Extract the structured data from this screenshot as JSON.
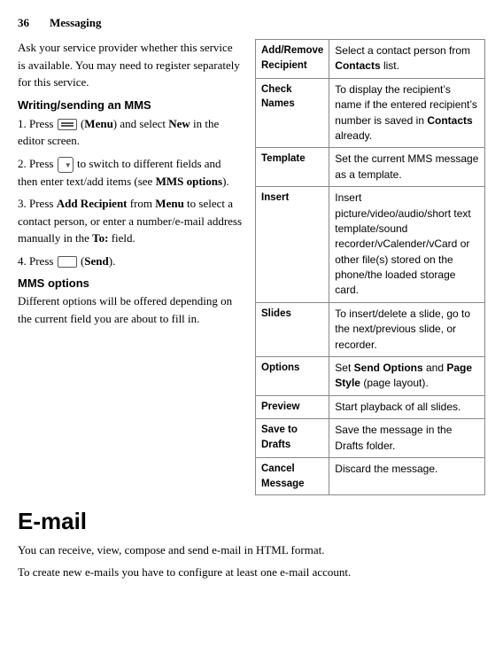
{
  "header": {
    "page_number": "36",
    "chapter": "Messaging"
  },
  "left": {
    "intro": "Ask your service provider whether this service is available. You may need to register separately for this service.",
    "writing_heading": "Writing/sending an MMS",
    "steps": [
      {
        "num": "1.",
        "parts": [
          {
            "text": "Press ",
            "type": "normal"
          },
          {
            "text": "icon_menu",
            "type": "icon"
          },
          {
            "text": " (",
            "type": "normal"
          },
          {
            "text": "Menu",
            "type": "bold"
          },
          {
            "text": ") and select ",
            "type": "normal"
          },
          {
            "text": "New",
            "type": "bold"
          },
          {
            "text": " in the editor screen.",
            "type": "normal"
          }
        ]
      },
      {
        "num": "2.",
        "parts": [
          {
            "text": "Press ",
            "type": "normal"
          },
          {
            "text": "icon_switch",
            "type": "icon"
          },
          {
            "text": " to switch to different fields and then enter text/add items (see ",
            "type": "normal"
          },
          {
            "text": "MMS options",
            "type": "bold"
          },
          {
            "text": ").",
            "type": "normal"
          }
        ]
      },
      {
        "num": "3.",
        "parts": [
          {
            "text": "Press ",
            "type": "normal"
          },
          {
            "text": "Add Recipient",
            "type": "bold"
          },
          {
            "text": " from ",
            "type": "normal"
          },
          {
            "text": "Menu",
            "type": "bold"
          },
          {
            "text": " to select a contact person, or enter a number/e-mail address manually in the ",
            "type": "normal"
          },
          {
            "text": "To:",
            "type": "bold"
          },
          {
            "text": " field.",
            "type": "normal"
          }
        ]
      },
      {
        "num": "4.",
        "parts": [
          {
            "text": "Press ",
            "type": "normal"
          },
          {
            "text": "icon_send",
            "type": "icon"
          },
          {
            "text": " (",
            "type": "normal"
          },
          {
            "text": "Send",
            "type": "bold"
          },
          {
            "text": ").",
            "type": "normal"
          }
        ]
      }
    ],
    "mms_options_heading": "MMS options",
    "mms_options_text": "Different options will be offered depending on the current field you are about to fill in."
  },
  "table": {
    "rows": [
      {
        "label": "Add/Remove Recipient",
        "desc": "Select a contact person from Contacts list."
      },
      {
        "label": "Check Names",
        "desc": "To display the recipient’s name if the entered recipient’s number is saved in Contacts already."
      },
      {
        "label": "Template",
        "desc": "Set the current MMS message as a template."
      },
      {
        "label": "Insert",
        "desc": "Insert picture/video/audio/short text template/sound recorder/vCalender/vCard or other file(s) stored on the phone/the loaded storage card."
      },
      {
        "label": "Slides",
        "desc": "To insert/delete a slide, go to the next/previous slide, or recorder."
      },
      {
        "label": "Options",
        "desc": "Set Send Options and Page Style (page layout)."
      },
      {
        "label": "Preview",
        "desc": "Start playback of all slides."
      },
      {
        "label": "Save to Drafts",
        "desc": "Save the message in the Drafts folder."
      },
      {
        "label": "Cancel Message",
        "desc": "Discard the message."
      }
    ]
  },
  "email_section": {
    "heading": "E-mail",
    "para1": "You can receive, view, compose and send e-mail in HTML format.",
    "para2": "To create new e-mails you have to configure at least one e-mail account."
  }
}
